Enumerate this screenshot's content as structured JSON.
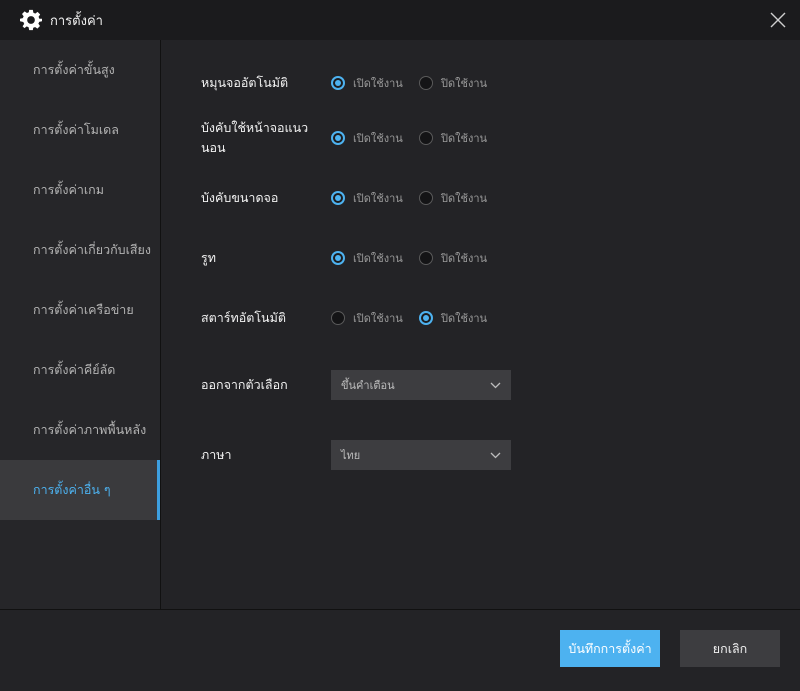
{
  "window": {
    "title": "การตั้งค่า"
  },
  "sidebar": {
    "items": [
      {
        "label": "การตั้งค่าขั้นสูง",
        "active": false
      },
      {
        "label": "การตั้งค่าโมเดล",
        "active": false
      },
      {
        "label": "การตั้งค่าเกม",
        "active": false
      },
      {
        "label": "การตั้งค่าเกี่ยวกับเสียง",
        "active": false
      },
      {
        "label": "การตั้งค่าเครือข่าย",
        "active": false
      },
      {
        "label": "การตั้งค่าคีย์ลัด",
        "active": false
      },
      {
        "label": "การตั้งค่าภาพพื้นหลัง",
        "active": false
      },
      {
        "label": "การตั้งค่าอื่น ๆ",
        "active": true
      }
    ]
  },
  "options": {
    "enable_label": "เปิดใช้งาน",
    "disable_label": "ปิดใช้งาน",
    "rows": [
      {
        "label": "หมุนจออัตโนมัติ",
        "value": "enable"
      },
      {
        "label": "บังคับใช้หน้าจอแนวนอน",
        "value": "enable"
      },
      {
        "label": "บังคับขนาดจอ",
        "value": "enable"
      },
      {
        "label": "รูท",
        "value": "enable"
      },
      {
        "label": "สตาร์ทอัตโนมัติ",
        "value": "disable"
      }
    ]
  },
  "exit_option": {
    "label": "ออกจากตัวเลือก",
    "value": "ขึ้นคำเตือน"
  },
  "language": {
    "label": "ภาษา",
    "value": "ไทย"
  },
  "footer": {
    "save_label": "บันทึกการตั้งค่า",
    "cancel_label": "ยกเลิก"
  },
  "colors": {
    "accent": "#4db2f0",
    "background": "#232326",
    "sidebar_active": "#3a3a3d"
  }
}
